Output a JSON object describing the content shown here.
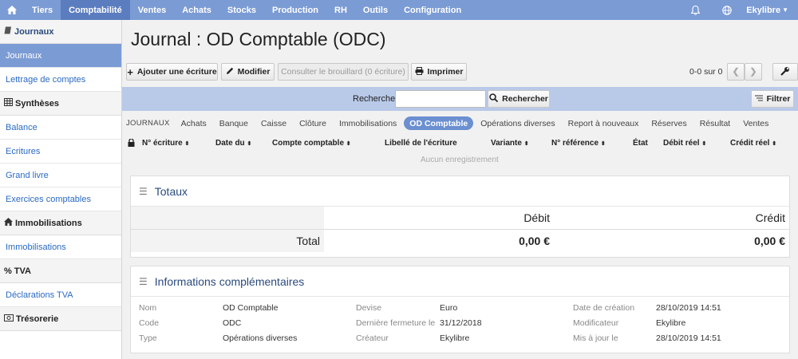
{
  "nav": {
    "items": [
      "Tiers",
      "Comptabilité",
      "Ventes",
      "Achats",
      "Stocks",
      "Production",
      "RH",
      "Outils",
      "Configuration"
    ],
    "user": "Ekylibre"
  },
  "sidebar": {
    "s1": "Journaux",
    "s1_items": [
      "Journaux",
      "Lettrage de comptes"
    ],
    "s2": "Synthèses",
    "s2_items": [
      "Balance",
      "Ecritures",
      "Grand livre",
      "Exercices comptables"
    ],
    "s3": "Immobilisations",
    "s3_items": [
      "Immobilisations"
    ],
    "s4": "TVA",
    "s4_items": [
      "Déclarations TVA"
    ],
    "s5": "Trésorerie"
  },
  "page": {
    "title": "Journal : OD Comptable (ODC)"
  },
  "toolbar": {
    "add": "Ajouter une écriture",
    "edit": "Modifier",
    "draft": "Consulter le brouillard (0 écriture)",
    "print": "Imprimer",
    "pageinfo": "0-0 sur 0"
  },
  "search": {
    "label": "Rechercher",
    "button": "Rechercher",
    "filter": "Filtrer",
    "value": ""
  },
  "journals": {
    "label": "JOURNAUX",
    "tabs": [
      "Achats",
      "Banque",
      "Caisse",
      "Clôture",
      "Immobilisations",
      "OD Comptable",
      "Opérations diverses",
      "Report à nouveaux",
      "Réserves",
      "Résultat",
      "Ventes"
    ],
    "active": "OD Comptable"
  },
  "table": {
    "headers": [
      "N° écriture",
      "Date du",
      "Compte comptable",
      "Libellé de l'écriture",
      "Variante",
      "N° référence",
      "État",
      "Débit réel",
      "Crédit réel"
    ],
    "empty": "Aucun enregistrement"
  },
  "totals": {
    "title": "Totaux",
    "debit_label": "Débit",
    "credit_label": "Crédit",
    "total_label": "Total",
    "debit": "0,00 €",
    "credit": "0,00 €"
  },
  "info": {
    "title": "Informations complémentaires",
    "col1": [
      {
        "k": "Nom",
        "v": "OD Comptable"
      },
      {
        "k": "Code",
        "v": "ODC"
      },
      {
        "k": "Type",
        "v": "Opérations diverses"
      }
    ],
    "col2": [
      {
        "k": "Devise",
        "v": "Euro"
      },
      {
        "k": "Dernière fermeture le",
        "v": "31/12/2018"
      },
      {
        "k": "Créateur",
        "v": "Ekylibre"
      }
    ],
    "col3": [
      {
        "k": "Date de création",
        "v": "28/10/2019 14:51"
      },
      {
        "k": "Modificateur",
        "v": "Ekylibre"
      },
      {
        "k": "Mis à jour le",
        "v": "28/10/2019 14:51"
      }
    ]
  }
}
